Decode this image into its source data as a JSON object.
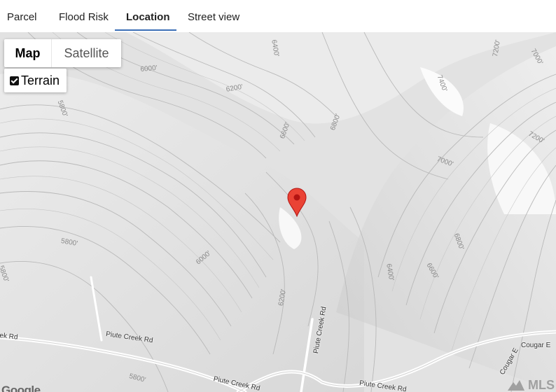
{
  "tabs": [
    {
      "label": "Parcel"
    },
    {
      "label": "Flood Risk"
    },
    {
      "label": "Location",
      "active": true
    },
    {
      "label": "Street view"
    }
  ],
  "map": {
    "type_buttons": {
      "map": "Map",
      "satellite": "Satellite"
    },
    "selected_type": "Map",
    "terrain": {
      "label": "Terrain",
      "checked": true
    },
    "contour_labels": [
      "6400'",
      "7000'",
      "6000'",
      "6200'",
      "7200'",
      "7400'",
      "5800'",
      "6600'",
      "6800'",
      "7000'",
      "7200'",
      "5800'",
      "6800'",
      "6000'",
      "5800'",
      "6600'",
      "6200'",
      "6400'",
      "5800'"
    ],
    "road_labels": [
      "Piute Creek Rd",
      "Piute Creek Rd",
      "Piute Creek Rd",
      "Piute Creek Rd",
      "ek Rd",
      "Cougar E",
      "Cougar E"
    ],
    "marker": {
      "icon": "map-marker-icon",
      "color": "#d93025"
    },
    "attribution": {
      "google": "Google",
      "mls": "MLS"
    }
  }
}
